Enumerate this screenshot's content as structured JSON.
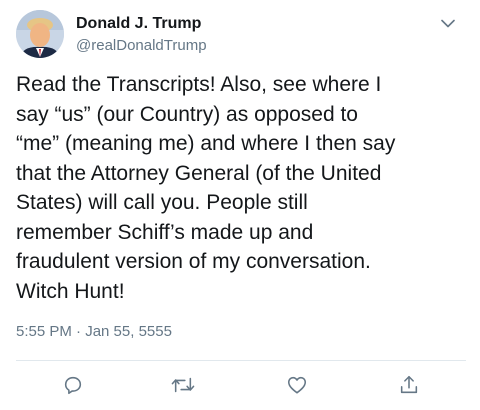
{
  "tweet": {
    "author": {
      "name": "Donald J. Trump",
      "handle": "@realDonaldTrump",
      "avatar_icon": "profile-photo"
    },
    "text": "Read the Transcripts! Also, see where I\nsay “us” (our Country) as opposed to\n“me” (meaning me) and where I then say\nthat the Attorney General (of the United\nStates) will call you. People still\nremember Schiff’s made up and\nfraudulent version of my conversation.\nWitch Hunt!",
    "timestamp": "5:55 PM · Jan 55, 5555",
    "menu_icon": "chevron-down-icon",
    "actions": [
      {
        "icon": "reply-icon"
      },
      {
        "icon": "retweet-icon"
      },
      {
        "icon": "like-icon"
      },
      {
        "icon": "share-icon"
      }
    ]
  },
  "colors": {
    "text": "#14171a",
    "secondary": "#657786",
    "icon": "#657786",
    "divider": "#e1e8ed"
  }
}
